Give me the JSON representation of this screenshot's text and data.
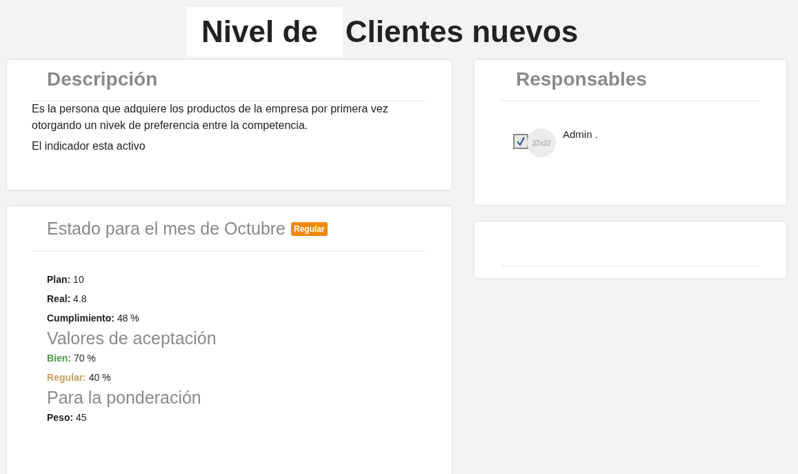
{
  "title": {
    "prefix": "Nivel de",
    "name": "Clientes nuevos"
  },
  "description": {
    "heading": "Descripción",
    "text": "Es la persona que adquiere los productos de la empresa por primera vez otorgando un nivek de preferencia entre la competencia.",
    "status": "El indicador esta activo"
  },
  "state": {
    "heading": "Estado para el mes de Octubre",
    "badge": "Regular",
    "values": [
      {
        "label": "Plan:",
        "value": "10"
      },
      {
        "label": "Real:",
        "value": "4.8"
      },
      {
        "label": "Cumplimiento:",
        "value": "48 %"
      }
    ],
    "acceptance_heading": "Valores de aceptación",
    "acceptance": [
      {
        "label": "Bien:",
        "value": "70 %",
        "color": "#4a9a4a"
      },
      {
        "label": "Regular:",
        "value": "40 %",
        "color": "#c8a060"
      }
    ],
    "weight_heading": "Para la ponderación",
    "weight": [
      {
        "label": "Peso:",
        "value": "45"
      }
    ]
  },
  "responsables": {
    "heading": "Responsables",
    "people": [
      {
        "checked": true,
        "avatar": "32x32",
        "name": "Admin ."
      }
    ]
  }
}
